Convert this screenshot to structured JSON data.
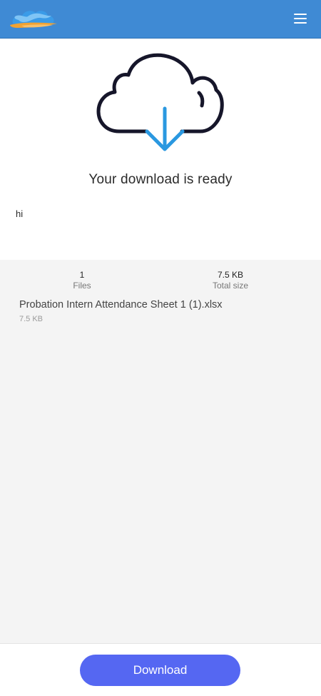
{
  "header": {
    "logo_icon": "cloud-logo-icon",
    "menu_icon": "hamburger-menu-icon",
    "background_color": "#3f8ad4"
  },
  "hero": {
    "illustration_icon": "cloud-download-icon",
    "title": "Your download is ready",
    "message": "hi"
  },
  "summary": {
    "files_count": "1",
    "files_label": "Files",
    "total_size": "7.5 KB",
    "total_size_label": "Total size"
  },
  "files": [
    {
      "name": "Probation Intern Attendance Sheet 1 (1).xlsx",
      "size": "7.5 KB"
    }
  ],
  "footer": {
    "download_label": "Download",
    "button_color": "#5567f2"
  }
}
